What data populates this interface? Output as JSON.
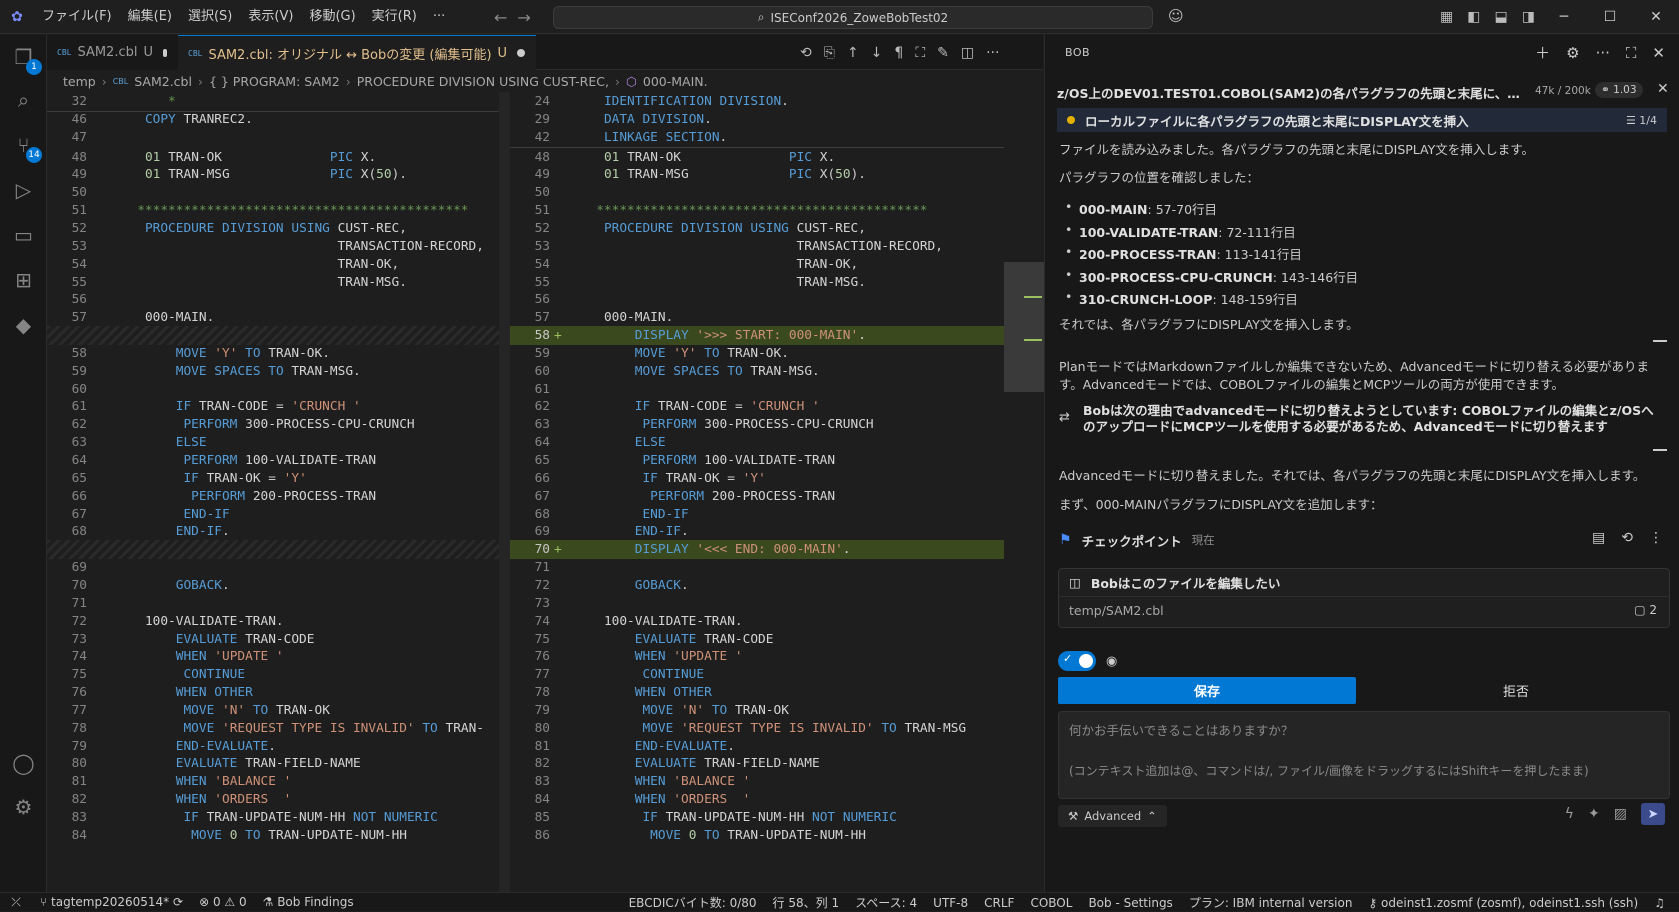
{
  "titlebar": {
    "menu": [
      "ファイル(F)",
      "編集(E)",
      "選択(S)",
      "表示(V)",
      "移動(G)",
      "実行(R)",
      "···"
    ],
    "search_text": "ISEConf2026_ZoweBobTest02"
  },
  "activity": {
    "explorer_badge": "1",
    "scm_badge": "14"
  },
  "tabs": [
    {
      "lang": "CBL",
      "label": "SAM2.cbl",
      "status": "U"
    },
    {
      "lang": "CBL",
      "label": "SAM2.cbl: オリジナル ↔ Bobの変更 (編集可能)",
      "status": "U"
    }
  ],
  "breadcrumbs": [
    "temp",
    "SAM2.cbl",
    "{ } PROGRAM: SAM2",
    "PROCEDURE DIVISION USING CUST-REC,",
    "000-MAIN."
  ],
  "left_pane": {
    "lines": [
      {
        "n": "32",
        "t": "          *"
      },
      {
        "n": "46",
        "t": "       COPY TRANREC2."
      },
      {
        "n": "47",
        "t": ""
      },
      {
        "n": "48",
        "t": "       01 TRAN-OK              PIC X."
      },
      {
        "n": "49",
        "t": "       01 TRAN-MSG             PIC X(50)."
      },
      {
        "n": "50",
        "t": ""
      },
      {
        "n": "51",
        "t": "      *******************************************"
      },
      {
        "n": "52",
        "t": "       PROCEDURE DIVISION USING CUST-REC,"
      },
      {
        "n": "53",
        "t": "                                TRANSACTION-RECORD,"
      },
      {
        "n": "54",
        "t": "                                TRAN-OK,"
      },
      {
        "n": "55",
        "t": "                                TRAN-MSG."
      },
      {
        "n": "56",
        "t": ""
      },
      {
        "n": "57",
        "t": "       000-MAIN."
      },
      {
        "n": "",
        "t": ""
      },
      {
        "n": "58",
        "t": "           MOVE 'Y' TO TRAN-OK."
      },
      {
        "n": "59",
        "t": "           MOVE SPACES TO TRAN-MSG."
      },
      {
        "n": "60",
        "t": ""
      },
      {
        "n": "61",
        "t": "           IF TRAN-CODE = 'CRUNCH '"
      },
      {
        "n": "62",
        "t": "            PERFORM 300-PROCESS-CPU-CRUNCH"
      },
      {
        "n": "63",
        "t": "           ELSE"
      },
      {
        "n": "64",
        "t": "            PERFORM 100-VALIDATE-TRAN"
      },
      {
        "n": "65",
        "t": "            IF TRAN-OK = 'Y'"
      },
      {
        "n": "66",
        "t": "             PERFORM 200-PROCESS-TRAN"
      },
      {
        "n": "67",
        "t": "            END-IF"
      },
      {
        "n": "68",
        "t": "           END-IF."
      },
      {
        "n": "",
        "t": ""
      },
      {
        "n": "69",
        "t": ""
      },
      {
        "n": "70",
        "t": "           GOBACK."
      },
      {
        "n": "71",
        "t": ""
      },
      {
        "n": "72",
        "t": "       100-VALIDATE-TRAN."
      },
      {
        "n": "73",
        "t": "           EVALUATE TRAN-CODE"
      },
      {
        "n": "74",
        "t": "           WHEN 'UPDATE '"
      },
      {
        "n": "75",
        "t": "            CONTINUE"
      },
      {
        "n": "76",
        "t": "           WHEN OTHER"
      },
      {
        "n": "77",
        "t": "            MOVE 'N' TO TRAN-OK"
      },
      {
        "n": "78",
        "t": "            MOVE 'REQUEST TYPE IS INVALID' TO TRAN-"
      },
      {
        "n": "79",
        "t": "           END-EVALUATE."
      },
      {
        "n": "80",
        "t": "           EVALUATE TRAN-FIELD-NAME"
      },
      {
        "n": "81",
        "t": "           WHEN 'BALANCE '"
      },
      {
        "n": "82",
        "t": "           WHEN 'ORDERS  '"
      },
      {
        "n": "83",
        "t": "            IF TRAN-UPDATE-NUM-HH NOT NUMERIC"
      },
      {
        "n": "84",
        "t": "             MOVE 0 TO TRAN-UPDATE-NUM-HH"
      }
    ]
  },
  "right_pane": {
    "lines": [
      {
        "n": "24",
        "t": "       IDENTIFICATION DIVISION."
      },
      {
        "n": "29",
        "t": "       DATA DIVISION."
      },
      {
        "n": "42",
        "t": "       LINKAGE SECTION."
      },
      {
        "n": "48",
        "t": "       01 TRAN-OK              PIC X."
      },
      {
        "n": "49",
        "t": "       01 TRAN-MSG             PIC X(50)."
      },
      {
        "n": "50",
        "t": ""
      },
      {
        "n": "51",
        "t": "      *******************************************"
      },
      {
        "n": "52",
        "t": "       PROCEDURE DIVISION USING CUST-REC,"
      },
      {
        "n": "53",
        "t": "                                TRANSACTION-RECORD,"
      },
      {
        "n": "54",
        "t": "                                TRAN-OK,"
      },
      {
        "n": "55",
        "t": "                                TRAN-MSG."
      },
      {
        "n": "56",
        "t": ""
      },
      {
        "n": "57",
        "t": "       000-MAIN."
      },
      {
        "n": "58",
        "t": "           DISPLAY '>>> START: 000-MAIN'."
      },
      {
        "n": "59",
        "t": "           MOVE 'Y' TO TRAN-OK."
      },
      {
        "n": "60",
        "t": "           MOVE SPACES TO TRAN-MSG."
      },
      {
        "n": "61",
        "t": ""
      },
      {
        "n": "62",
        "t": "           IF TRAN-CODE = 'CRUNCH '"
      },
      {
        "n": "63",
        "t": "            PERFORM 300-PROCESS-CPU-CRUNCH"
      },
      {
        "n": "64",
        "t": "           ELSE"
      },
      {
        "n": "65",
        "t": "            PERFORM 100-VALIDATE-TRAN"
      },
      {
        "n": "66",
        "t": "            IF TRAN-OK = 'Y'"
      },
      {
        "n": "67",
        "t": "             PERFORM 200-PROCESS-TRAN"
      },
      {
        "n": "68",
        "t": "            END-IF"
      },
      {
        "n": "69",
        "t": "           END-IF."
      },
      {
        "n": "70",
        "t": "           DISPLAY '<<< END: 000-MAIN'."
      },
      {
        "n": "71",
        "t": ""
      },
      {
        "n": "72",
        "t": "           GOBACK."
      },
      {
        "n": "73",
        "t": ""
      },
      {
        "n": "74",
        "t": "       100-VALIDATE-TRAN."
      },
      {
        "n": "75",
        "t": "           EVALUATE TRAN-CODE"
      },
      {
        "n": "76",
        "t": "           WHEN 'UPDATE '"
      },
      {
        "n": "77",
        "t": "            CONTINUE"
      },
      {
        "n": "78",
        "t": "           WHEN OTHER"
      },
      {
        "n": "79",
        "t": "            MOVE 'N' TO TRAN-OK"
      },
      {
        "n": "80",
        "t": "            MOVE 'REQUEST TYPE IS INVALID' TO TRAN-MSG"
      },
      {
        "n": "81",
        "t": "           END-EVALUATE."
      },
      {
        "n": "82",
        "t": "           EVALUATE TRAN-FIELD-NAME"
      },
      {
        "n": "83",
        "t": "           WHEN 'BALANCE '"
      },
      {
        "n": "84",
        "t": "           WHEN 'ORDERS  '"
      },
      {
        "n": "85",
        "t": "            IF TRAN-UPDATE-NUM-HH NOT NUMERIC"
      },
      {
        "n": "86",
        "t": "             MOVE 0 TO TRAN-UPDATE-NUM-HH"
      }
    ]
  },
  "chat": {
    "panel_title": "BOB",
    "task_title": "z/OS上のDEV01.TEST01.COBOL(SAM2)の各パラグラフの先頭と末尾に、デバ...",
    "tokens": "47k / 200k",
    "cost": "1.03",
    "todo_label": "ローカルファイルに各パラグラフの先頭と末尾にDISPLAY文を挿入",
    "todo_count": "1/4",
    "msg1": "ファイルを読み込みました。各パラグラフの先頭と末尾にDISPLAY文を挿入します。",
    "msg2": "パラグラフの位置を確認しました：",
    "paragraphs": [
      {
        "name": "000-MAIN",
        "range": ": 57-70行目"
      },
      {
        "name": "100-VALIDATE-TRAN",
        "range": ": 72-111行目"
      },
      {
        "name": "200-PROCESS-TRAN",
        "range": ": 113-141行目"
      },
      {
        "name": "300-PROCESS-CPU-CRUNCH",
        "range": ": 143-146行目"
      },
      {
        "name": "310-CRUNCH-LOOP",
        "range": ": 148-159行目"
      }
    ],
    "msg3": "それでは、各パラグラフにDISPLAY文を挿入します。",
    "msg4": "PlanモードではMarkdownファイルしか編集できないため、Advancedモードに切り替える必要があります。Advancedモードでは、COBOLファイルの編集とMCPツールの両方が使用できます。",
    "switch_note": "Bobは次の理由でadvancedモードに切り替えようとしています: COBOLファイルの編集とz/OSへのアップロードにMCPツールを使用する必要があるため、Advancedモードに切り替えます",
    "msg5": "Advancedモードに切り替えました。それでは、各パラグラフの先頭と末尾にDISPLAY文を挿入します。",
    "msg6": "まず、000-MAINパラグラフにDISPLAY文を追加します：",
    "checkpoint_label": "チェックポイント",
    "checkpoint_now": "現在",
    "edit_card_title": "Bobはこのファイルを編集したい",
    "edit_card_file": "temp/SAM2.cbl",
    "edit_card_count": "2",
    "save_label": "保存",
    "reject_label": "拒否",
    "input_placeholder": "何かお手伝いできることはありますか？",
    "input_hint": "(コンテキスト追加は@、コマンドは/, ファイル/画像をドラッグするにはShiftキーを押したまま)",
    "mode_label": "Advanced"
  },
  "statusbar": {
    "branch": "tagtemp20260514*",
    "errors": "0",
    "warnings": "0",
    "findings": "Bob Findings",
    "ebcdic": "EBCDICバイト数: 0/80",
    "position": "行 58、列 1",
    "spaces": "スペース: 4",
    "encoding": "UTF-8",
    "eol": "CRLF",
    "language": "COBOL",
    "bob_settings": "Bob - Settings",
    "plan": "プラン: IBM internal version",
    "connection": "odeinst1.zosmf (zosmf), odeinst1.ssh (ssh)"
  },
  "colors": {
    "accent": "#0078d4",
    "added_line": "#3b4a1e",
    "keyword": "#569cd6",
    "string": "#ce9178",
    "comment": "#6a9955"
  }
}
